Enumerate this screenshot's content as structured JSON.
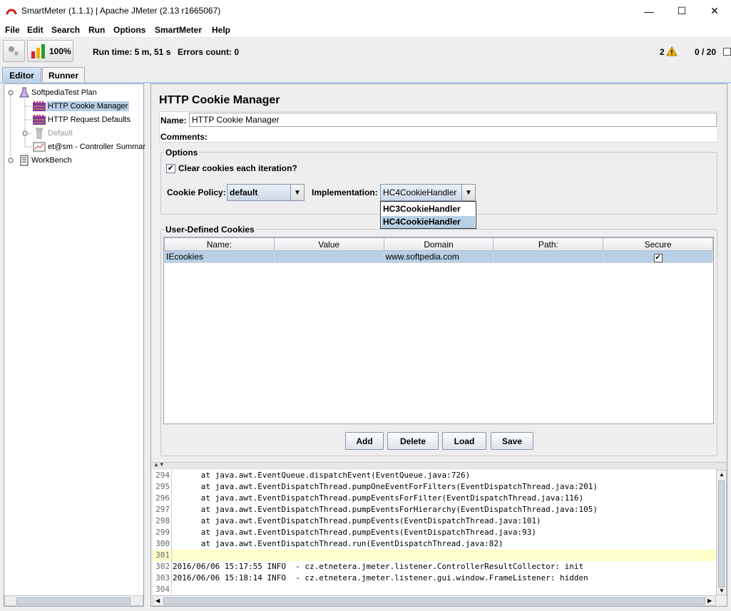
{
  "window": {
    "title": "SmartMeter (1.1.1) | Apache JMeter (2.13 r1665067)",
    "minimize": "—",
    "maximize": "☐",
    "close": "✕"
  },
  "menubar": {
    "items": [
      {
        "label": "File"
      },
      {
        "label": "Edit"
      },
      {
        "label": "Search"
      },
      {
        "label": "Run"
      },
      {
        "label": "Options"
      },
      {
        "label": "SmartMeter"
      },
      {
        "label": "Help"
      }
    ]
  },
  "toolbar": {
    "progress_label": "100%",
    "run_time": "Run time: 5 m, 51 s",
    "errors_count": "Errors count: 0",
    "warnings_count": "2",
    "threads": "0 / 20"
  },
  "tabs": [
    {
      "label": "Editor",
      "active": true
    },
    {
      "label": "Runner",
      "active": false
    }
  ],
  "tree": {
    "items": [
      {
        "label": "SoftpediaTest Plan",
        "icon": "flask-icon"
      },
      {
        "label": "HTTP Cookie Manager",
        "icon": "cookie-manager-icon",
        "selected": true
      },
      {
        "label": "HTTP Request Defaults",
        "icon": "request-defaults-icon"
      },
      {
        "label": "Default",
        "icon": "thread-group-icon",
        "disabled": true
      },
      {
        "label": "et@sm - Controller Summar",
        "icon": "summary-report-icon"
      },
      {
        "label": "WorkBench",
        "icon": "workbench-icon"
      }
    ]
  },
  "panel": {
    "heading": "HTTP Cookie Manager",
    "name_label": "Name:",
    "name_value": "HTTP Cookie Manager",
    "comments_label": "Comments:",
    "options_title": "Options",
    "clear_cookies_label": "Clear cookies each iteration?",
    "clear_cookies_checked": true,
    "cookie_policy_label": "Cookie Policy:",
    "cookie_policy_value": "default",
    "implementation_label": "Implementation:",
    "implementation_value": "HC4CookieHandler",
    "implementation_options": [
      "HC3CookieHandler",
      "HC4CookieHandler"
    ],
    "cookies_title": "User-Defined Cookies",
    "columns": [
      "Name:",
      "Value",
      "Domain",
      "Path:",
      "Secure"
    ],
    "rows": [
      {
        "name": "IEcookies",
        "value": "",
        "domain": "www.softpedia.com",
        "path": "",
        "secure": true
      }
    ],
    "buttons": {
      "add": "Add",
      "delete": "Delete",
      "load": "Load",
      "save": "Save"
    }
  },
  "log": {
    "lines": [
      {
        "n": "294",
        "text": "      at java.awt.EventQueue.dispatchEvent(EventQueue.java:726)"
      },
      {
        "n": "295",
        "text": "      at java.awt.EventDispatchThread.pumpOneEventForFilters(EventDispatchThread.java:201)"
      },
      {
        "n": "296",
        "text": "      at java.awt.EventDispatchThread.pumpEventsForFilter(EventDispatchThread.java:116)"
      },
      {
        "n": "297",
        "text": "      at java.awt.EventDispatchThread.pumpEventsForHierarchy(EventDispatchThread.java:105)"
      },
      {
        "n": "298",
        "text": "      at java.awt.EventDispatchThread.pumpEvents(EventDispatchThread.java:101)"
      },
      {
        "n": "299",
        "text": "      at java.awt.EventDispatchThread.pumpEvents(EventDispatchThread.java:93)"
      },
      {
        "n": "300",
        "text": "      at java.awt.EventDispatchThread.run(EventDispatchThread.java:82)"
      },
      {
        "n": "301",
        "text": "",
        "highlight": true
      },
      {
        "n": "302",
        "text": "2016/06/06 15:17:55 INFO  - cz.etnetera.jmeter.listener.ControllerResultCollector: init"
      },
      {
        "n": "303",
        "text": "2016/06/06 15:18:14 INFO  - cz.etnetera.jmeter.listener.gui.window.FrameListener: hidden"
      },
      {
        "n": "304",
        "text": ""
      }
    ]
  },
  "colors": {
    "selection": "#b8cfe5",
    "highlight_line": "#ffffcc",
    "warning": "#f5b800"
  }
}
